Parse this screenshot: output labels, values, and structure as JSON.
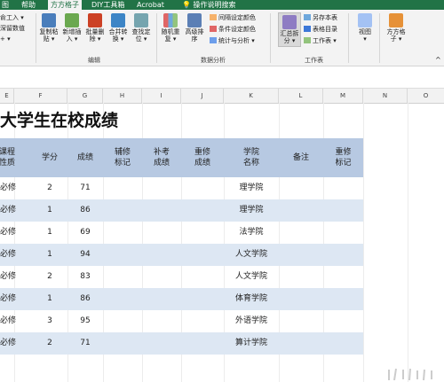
{
  "ribbon_tabs": [
    "图",
    "帮助",
    "方方格子",
    "DIY工具箱",
    "Acrobat",
    "操作说明搜索"
  ],
  "ribbon": {
    "left_partial": [
      "俞工入 ▾",
      "深留数值",
      "+ ▾"
    ],
    "edit_buttons": [
      {
        "label": "复制粘\n贴 ▾",
        "icon": "copy-paste-icon"
      },
      {
        "label": "新增插\n入 ▾",
        "icon": "insert-icon"
      },
      {
        "label": "批量删\n除 ▾",
        "icon": "batch-delete-icon"
      },
      {
        "label": "合并转\n换 ▾",
        "icon": "merge-convert-icon"
      },
      {
        "label": "查找定\n位 ▾",
        "icon": "find-locate-icon"
      }
    ],
    "edit_group": "编辑",
    "analysis_buttons": [
      {
        "label": "随机重\n复 ▾",
        "icon": "random-repeat-icon"
      },
      {
        "label": "高级排\n序",
        "icon": "advanced-sort-icon"
      }
    ],
    "analysis_small": [
      {
        "label": "间隔设定颜色",
        "icon": "interval-color-icon"
      },
      {
        "label": "条件设定颜色",
        "icon": "conditional-color-icon"
      },
      {
        "label": "统计与分析 ▾",
        "icon": "statistics-icon"
      }
    ],
    "analysis_group": "数据分析",
    "summary_button": {
      "label": "汇总拆\n分 ▾",
      "icon": "summary-split-icon"
    },
    "sheet_small": [
      {
        "label": "另存本表",
        "icon": "save-sheet-icon"
      },
      {
        "label": "表格目录",
        "icon": "sheet-directory-icon"
      },
      {
        "label": "工作表 ▾",
        "icon": "worksheet-icon"
      }
    ],
    "sheet_group": "工作表",
    "view_button": {
      "label": "视图\n▾",
      "icon": "view-icon"
    },
    "ffgz_button": {
      "label": "方方格\n子 ▾",
      "icon": "ffgz-icon"
    }
  },
  "column_headers": [
    "E",
    "F",
    "G",
    "H",
    "I",
    "J",
    "K",
    "L",
    "M",
    "N",
    "O"
  ],
  "sheet": {
    "title": "大学生在校成绩",
    "headers": [
      "课程\n性质",
      "学分",
      "成绩",
      "辅修\n标记",
      "补考\n成绩",
      "重修\n成绩",
      "学院\n名称",
      "备注",
      "重修\n标记"
    ],
    "rows": [
      [
        "必修",
        "2",
        "71",
        "",
        "",
        "",
        "理学院",
        "",
        ""
      ],
      [
        "必修",
        "1",
        "86",
        "",
        "",
        "",
        "理学院",
        "",
        ""
      ],
      [
        "必修",
        "1",
        "69",
        "",
        "",
        "",
        "法学院",
        "",
        ""
      ],
      [
        "必修",
        "1",
        "94",
        "",
        "",
        "",
        "人文学院",
        "",
        ""
      ],
      [
        "必修",
        "2",
        "83",
        "",
        "",
        "",
        "人文学院",
        "",
        ""
      ],
      [
        "必修",
        "1",
        "86",
        "",
        "",
        "",
        "体育学院",
        "",
        ""
      ],
      [
        "必修",
        "3",
        "95",
        "",
        "",
        "",
        "外语学院",
        "",
        ""
      ],
      [
        "必修",
        "2",
        "71",
        "",
        "",
        "",
        "算计学院",
        "",
        ""
      ]
    ]
  },
  "colors": {
    "excel_green": "#217346",
    "header_blue": "#b7c9e2",
    "band_blue": "#dde7f3"
  }
}
